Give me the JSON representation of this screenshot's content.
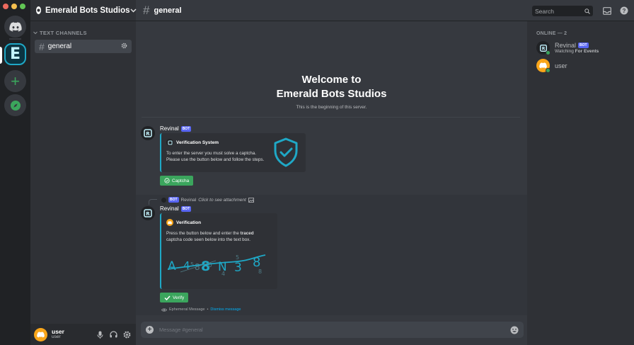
{
  "window": {
    "controls": [
      "close",
      "minimize",
      "maximize"
    ]
  },
  "servers": {
    "home_label": "Direct Messages",
    "active_initial": "E",
    "add_label": "+",
    "explore_label": "Explore"
  },
  "guild": {
    "name": "Emerald Bots Studios"
  },
  "sidebar": {
    "category": "TEXT CHANNELS",
    "channels": [
      {
        "name": "general"
      }
    ]
  },
  "user_panel": {
    "name": "user",
    "tag": "user"
  },
  "topbar": {
    "channel": "general",
    "search_placeholder": "Search"
  },
  "welcome": {
    "title_line1": "Welcome to",
    "title_line2": "Emerald Bots Studios",
    "subtitle": "This is the beginning of this server."
  },
  "messages": [
    {
      "author": "Revinal",
      "badge": "BOT",
      "embed": {
        "title": "Verification System",
        "desc_line1": "To enter the server you must solve a captcha.",
        "desc_line2": "Please use the button below and follow the steps."
      },
      "button": "Captcha"
    },
    {
      "reply": {
        "badge": "BOT",
        "author": "Revinal",
        "text": "Click to see attachment"
      },
      "author": "Revinal",
      "badge": "BOT",
      "embed": {
        "title": "Verification",
        "desc_pre": "Press the button below and enter the ",
        "desc_bold": "traced",
        "desc_line2": "captcha code seen below into the text box."
      },
      "button": "Verify",
      "ephemeral": {
        "label": "Ephemeral Message",
        "sep": " • ",
        "dismiss": "Dismiss message"
      }
    }
  ],
  "composer": {
    "placeholder": "Message #general"
  },
  "members": {
    "header": "ONLINE — 2",
    "list": [
      {
        "name": "Revinal",
        "badge": "BOT",
        "activity_prefix": "Watching ",
        "activity": "For Events"
      },
      {
        "name": "user"
      }
    ]
  },
  "colors": {
    "accent": "#1fa8c6",
    "green": "#3ba55d",
    "blurple": "#5865f2",
    "online": "#3ba55d"
  }
}
